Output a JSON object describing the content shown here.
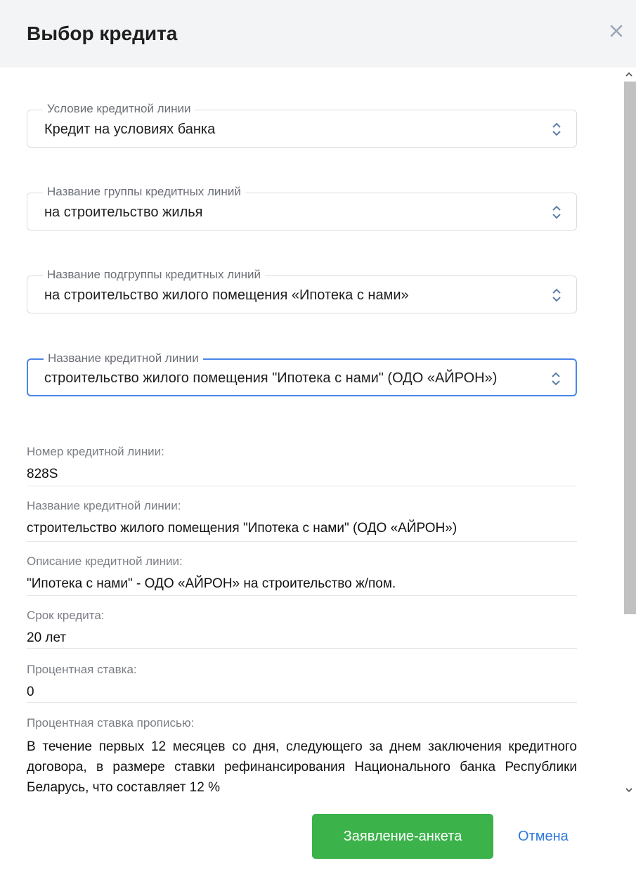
{
  "dialog": {
    "title": "Выбор кредита"
  },
  "fields": [
    {
      "label": "Условие кредитной линии",
      "value": "Кредит на условиях банка"
    },
    {
      "label": "Название группы кредитных линий",
      "value": "на строительство жилья"
    },
    {
      "label": "Название подгруппы кредитных линий",
      "value": "на строительство жилого помещения «Ипотека с нами»"
    },
    {
      "label": "Название кредитной линии",
      "value": "строительство жилого помещения \"Ипотека с нами\" (ОДО «АЙРОН»)"
    }
  ],
  "info": [
    {
      "label": "Номер кредитной линии:",
      "value": "828S"
    },
    {
      "label": "Название кредитной линии:",
      "value": "строительство жилого помещения \"Ипотека с нами\" (ОДО «АЙРОН»)"
    },
    {
      "label": "Описание кредитной линии:",
      "value": "\"Ипотека с нами\" - ОДО «АЙРОН» на строительство ж/пом."
    },
    {
      "label": "Срок кредита:",
      "value": "20 лет"
    },
    {
      "label": "Процентная ставка:",
      "value": "0"
    },
    {
      "label": "Процентная ставка прописью:",
      "value": "В течение первых 12 месяцев со дня, следующего за днем заключения кредитного договора, в размере ставки рефинансирования Национального банка Республики Беларусь, что составляет 12 %"
    }
  ],
  "footer": {
    "submit_label": "Заявление-анкета",
    "cancel_label": "Отмена"
  },
  "colors": {
    "primary_button": "#3bb24a",
    "link": "#2f7ad8",
    "focus_border": "#4a86e8",
    "header_bg": "#f3f4f6"
  },
  "icons": {
    "close": "close-icon",
    "select_arrows": "chevron-up-down-icon"
  }
}
